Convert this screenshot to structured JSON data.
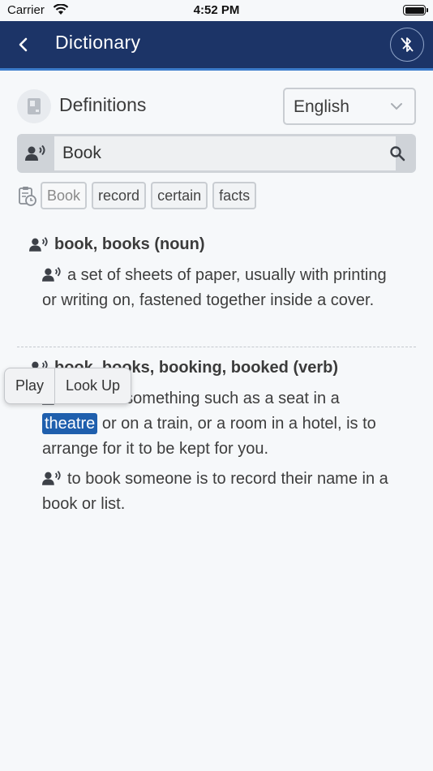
{
  "status_bar": {
    "carrier": "Carrier",
    "time": "4:52 PM",
    "battery_level": 1.0
  },
  "nav": {
    "title": "Dictionary",
    "back_icon": "chevron-left-icon",
    "bluetooth_icon": "bluetooth-off-icon"
  },
  "header": {
    "title": "Definitions",
    "language": "English"
  },
  "search": {
    "value": "Book"
  },
  "history": [
    "Book",
    "record",
    "certain",
    "facts"
  ],
  "entries": [
    {
      "heading": "book, books (noun)",
      "definitions": [
        "a set of sheets of paper, usually with printing or writing on, fastened together inside a cover."
      ]
    },
    {
      "heading": "book, books, booking, booked (verb)",
      "definitions": [
        {
          "before": "to book something such as a seat in a",
          "selected": "theatre",
          "after": "or on a train, or a room in a hotel, is to arrange for it to be kept for you."
        },
        "to book someone is to record their name in a book or list."
      ]
    }
  ],
  "context_menu": [
    "Play",
    "Look Up"
  ],
  "colors": {
    "nav_background": "#1c3467",
    "nav_accent": "#3c7ccb",
    "selection": "#1f5fad",
    "page_background": "#f6f8fa"
  }
}
